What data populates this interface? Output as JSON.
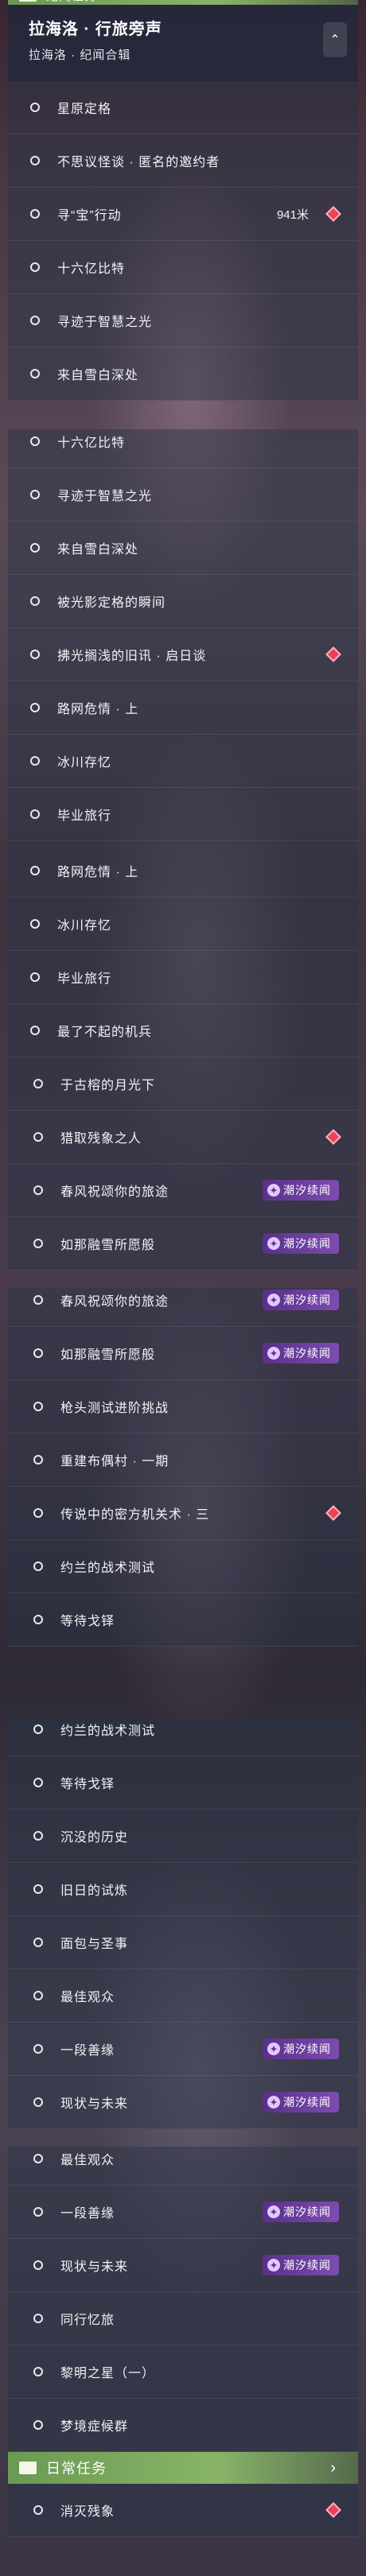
{
  "colors": {
    "accent_purple": "#6a3b9c",
    "alert_red": "#e8435a",
    "section_green": "#7aa85c"
  },
  "panels": [
    {
      "top_section": "纪闻任务",
      "header": {
        "title": "拉海洛 · 行旅旁声",
        "subtitle": "拉海洛 · 纪闻合辑"
      },
      "items": [
        {
          "label": "星原定格"
        },
        {
          "label": "不思议怪谈 · 匿名的邀约者"
        },
        {
          "label": "寻“宝”行动",
          "distance": "941米",
          "alert": true
        },
        {
          "label": "十六亿比特"
        },
        {
          "label": "寻迹于智慧之光"
        },
        {
          "label": "来自雪白深处"
        }
      ]
    },
    {
      "items": [
        {
          "label": "十六亿比特"
        },
        {
          "label": "寻迹于智慧之光"
        },
        {
          "label": "来自雪白深处"
        },
        {
          "label": "被光影定格的瞬间"
        },
        {
          "label": "拂光搁浅的旧讯 · 启日谈",
          "alert": true
        },
        {
          "label": "路网危情 · 上"
        },
        {
          "label": "冰川存忆"
        },
        {
          "label": "毕业旅行"
        },
        {
          "label": "最了不起的机兵"
        }
      ]
    },
    {
      "items": [
        {
          "label": "路网危情 · 上"
        },
        {
          "label": "冰川存忆"
        },
        {
          "label": "毕业旅行"
        },
        {
          "label": "最了不起的机兵"
        },
        {
          "label": "于古榕的月光下",
          "wide": true
        },
        {
          "label": "猎取残象之人",
          "wide": true,
          "alert": true
        },
        {
          "label": "春风祝颂你的旅途",
          "wide": true,
          "tag": "潮汐续闻"
        },
        {
          "label": "如那融雪所愿般",
          "wide": true,
          "tag": "潮汐续闻"
        }
      ]
    },
    {
      "items": [
        {
          "label": "春风祝颂你的旅途",
          "wide": true,
          "tag": "潮汐续闻"
        },
        {
          "label": "如那融雪所愿般",
          "wide": true,
          "tag": "潮汐续闻"
        },
        {
          "label": "枪头测试进阶挑战",
          "wide": true
        },
        {
          "label": "重建布偶村 · 一期",
          "wide": true
        },
        {
          "label": "传说中的密方机关术 · 三",
          "wide": true,
          "alert": true
        },
        {
          "label": "约兰的战术测试",
          "wide": true
        },
        {
          "label": "等待戈铎",
          "wide": true
        }
      ]
    },
    {
      "items": [
        {
          "label": "约兰的战术测试",
          "wide": true
        },
        {
          "label": "等待戈铎",
          "wide": true
        },
        {
          "label": "沉没的历史",
          "wide": true
        },
        {
          "label": "旧日的试炼",
          "wide": true
        },
        {
          "label": "面包与圣事",
          "wide": true
        },
        {
          "label": "最佳观众",
          "wide": true
        },
        {
          "label": "一段善缘",
          "wide": true,
          "tag": "潮汐续闻"
        },
        {
          "label": "现状与未来",
          "wide": true,
          "tag": "潮汐续闻"
        }
      ]
    },
    {
      "items": [
        {
          "label": "最佳观众",
          "wide": true
        },
        {
          "label": "一段善缘",
          "wide": true,
          "tag": "潮汐续闻"
        },
        {
          "label": "现状与未来",
          "wide": true,
          "tag": "潮汐续闻"
        },
        {
          "label": "同行忆旅",
          "wide": true
        },
        {
          "label": "黎明之星（一）",
          "wide": true
        },
        {
          "label": "梦境症候群",
          "wide": true
        }
      ],
      "section": "日常任务",
      "after": [
        {
          "label": "消灭残象",
          "wide": true,
          "alert": true
        }
      ]
    }
  ]
}
